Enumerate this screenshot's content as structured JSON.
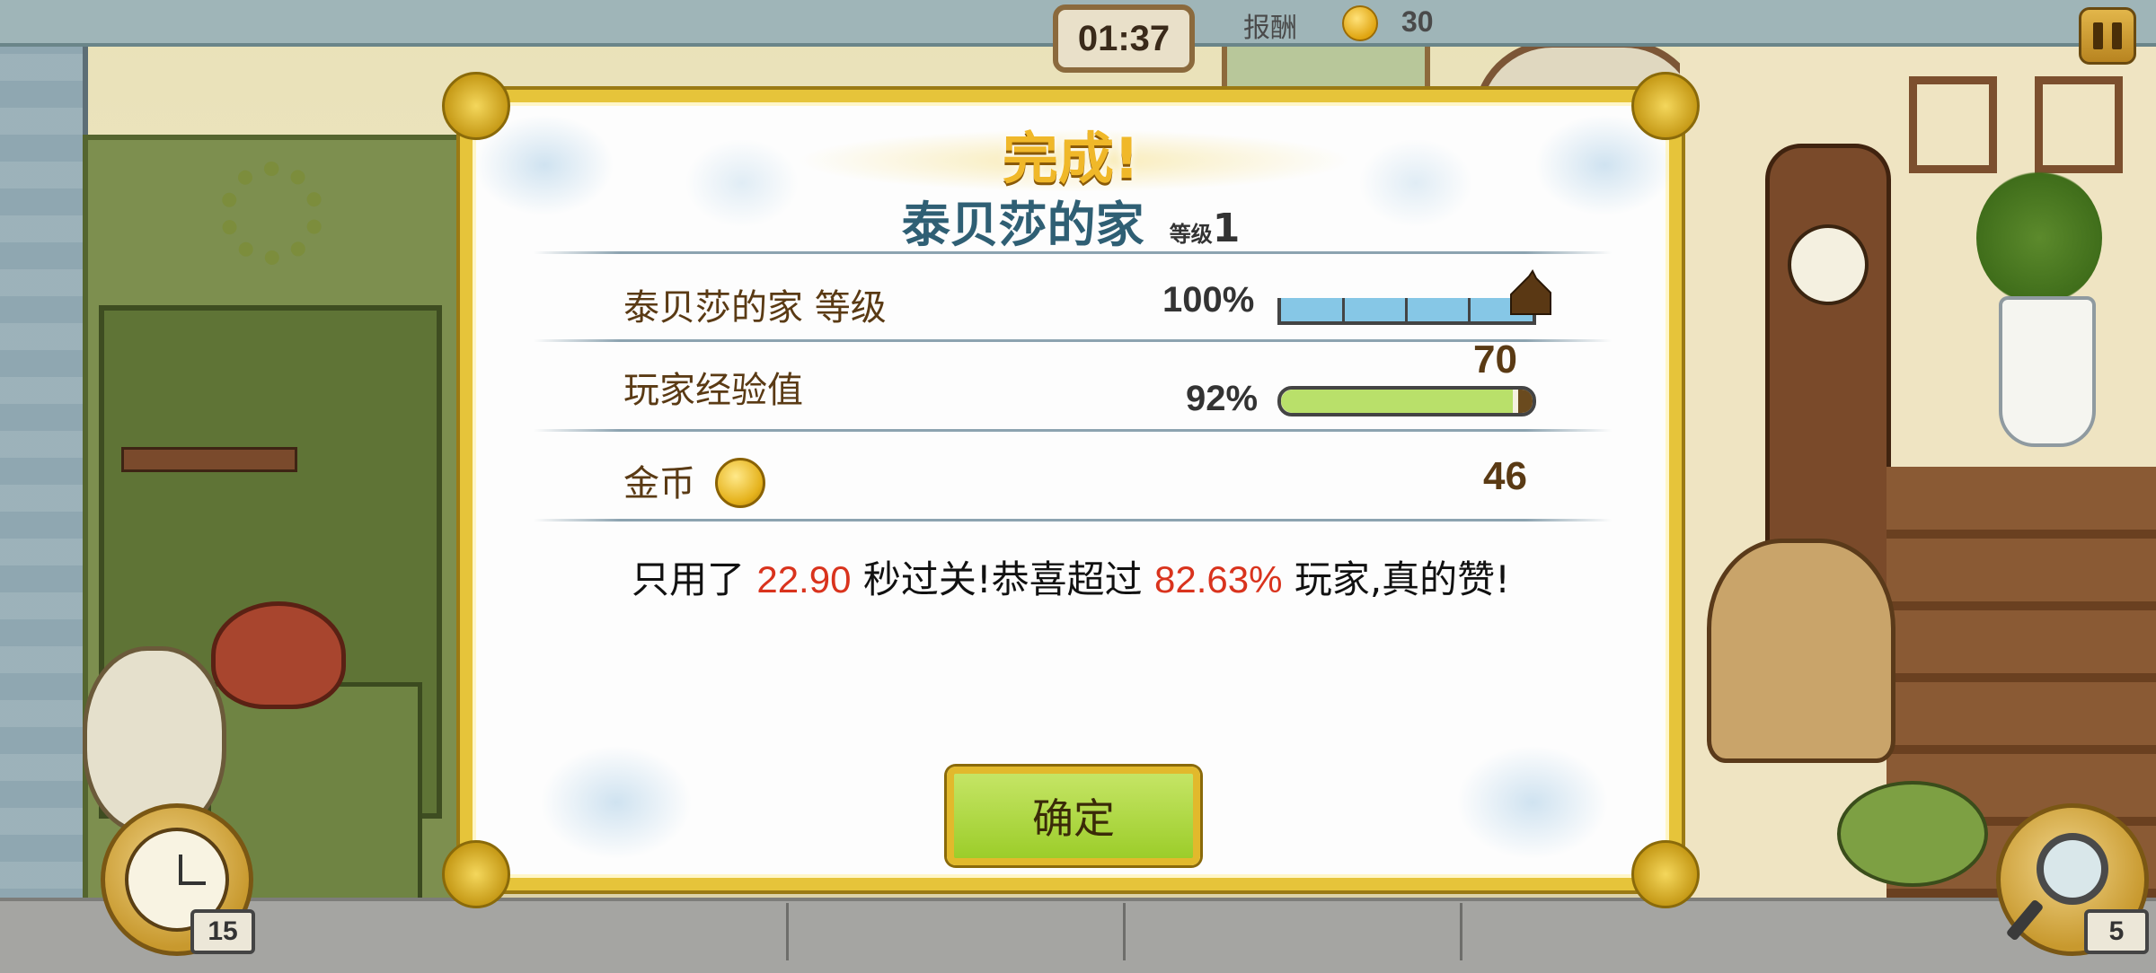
{
  "hud": {
    "timer": "01:37",
    "reward_label": "报酬",
    "reward_value": "30"
  },
  "dialog": {
    "complete_title": "完成!",
    "home_name": "泰贝莎的家",
    "level_label": "等级",
    "level_value": "1",
    "rows": [
      {
        "label": "泰贝莎的家 等级",
        "percent": "100%",
        "progress": 1.0
      },
      {
        "label": "玩家经验值",
        "percent": "92%",
        "progress": 0.92,
        "value": "70"
      },
      {
        "label": "金币",
        "value": "46"
      }
    ],
    "summary": {
      "prefix": "只用了",
      "time": "22.90",
      "middle": "秒过关!恭喜超过",
      "percent": "82.63%",
      "suffix": "玩家,真的赞!"
    },
    "confirm_label": "确定"
  },
  "tools": {
    "clock_count": "15",
    "magnifier_count": "5"
  },
  "colors": {
    "highlight": "#d9331d",
    "title_gold": "#f0b829",
    "home_blue": "#2f5f74",
    "confirm_green": "#9ccd2a"
  }
}
